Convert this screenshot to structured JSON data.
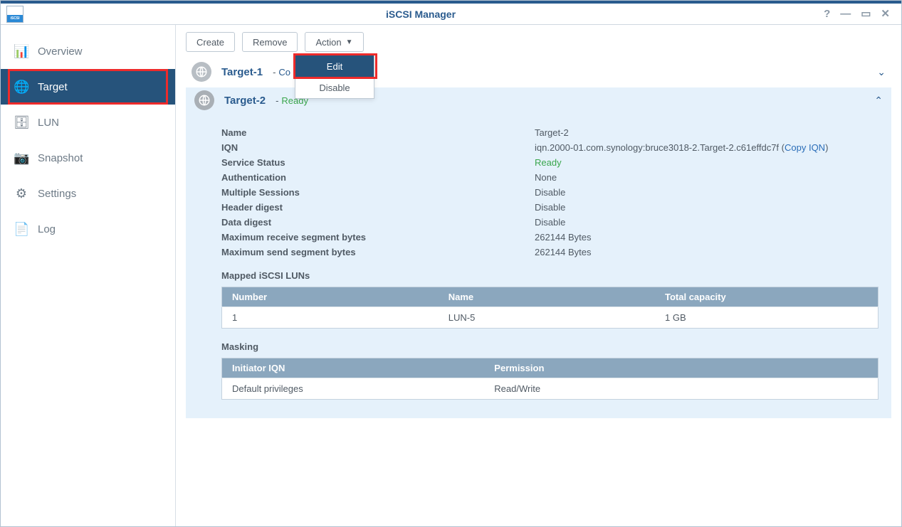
{
  "window": {
    "title": "iSCSI Manager"
  },
  "sidebar": {
    "items": [
      {
        "label": "Overview",
        "icon": "overview-icon"
      },
      {
        "label": "Target",
        "icon": "target-icon"
      },
      {
        "label": "LUN",
        "icon": "lun-icon"
      },
      {
        "label": "Snapshot",
        "icon": "snapshot-icon"
      },
      {
        "label": "Settings",
        "icon": "settings-icon"
      },
      {
        "label": "Log",
        "icon": "log-icon"
      }
    ]
  },
  "toolbar": {
    "create": "Create",
    "remove": "Remove",
    "action": "Action"
  },
  "action_menu": {
    "edit": "Edit",
    "disable": "Disable"
  },
  "targets": {
    "t1": {
      "name": "Target-1",
      "status_prefix": " - ",
      "status": "Co"
    },
    "t2": {
      "name": "Target-2",
      "status_prefix": " - ",
      "status": "Ready",
      "details": {
        "name_label": "Name",
        "name_value": "Target-2",
        "iqn_label": "IQN",
        "iqn_value": "iqn.2000-01.com.synology:bruce3018-2.Target-2.c61effdc7f",
        "copy_iqn": "Copy IQN",
        "service_status_label": "Service Status",
        "service_status_value": "Ready",
        "auth_label": "Authentication",
        "auth_value": "None",
        "multi_sessions_label": "Multiple Sessions",
        "multi_sessions_value": "Disable",
        "header_digest_label": "Header digest",
        "header_digest_value": "Disable",
        "data_digest_label": "Data digest",
        "data_digest_value": "Disable",
        "max_recv_label": "Maximum receive segment bytes",
        "max_recv_value": "262144 Bytes",
        "max_send_label": "Maximum send segment bytes",
        "max_send_value": "262144 Bytes"
      },
      "luns_title": "Mapped iSCSI LUNs",
      "luns_cols": {
        "number": "Number",
        "name": "Name",
        "capacity": "Total capacity"
      },
      "luns_rows": [
        {
          "number": "1",
          "name": "LUN-5",
          "capacity": "1 GB"
        }
      ],
      "masking_title": "Masking",
      "masking_cols": {
        "iqn": "Initiator IQN",
        "perm": "Permission"
      },
      "masking_rows": [
        {
          "iqn": "Default privileges",
          "perm": "Read/Write"
        }
      ]
    }
  }
}
